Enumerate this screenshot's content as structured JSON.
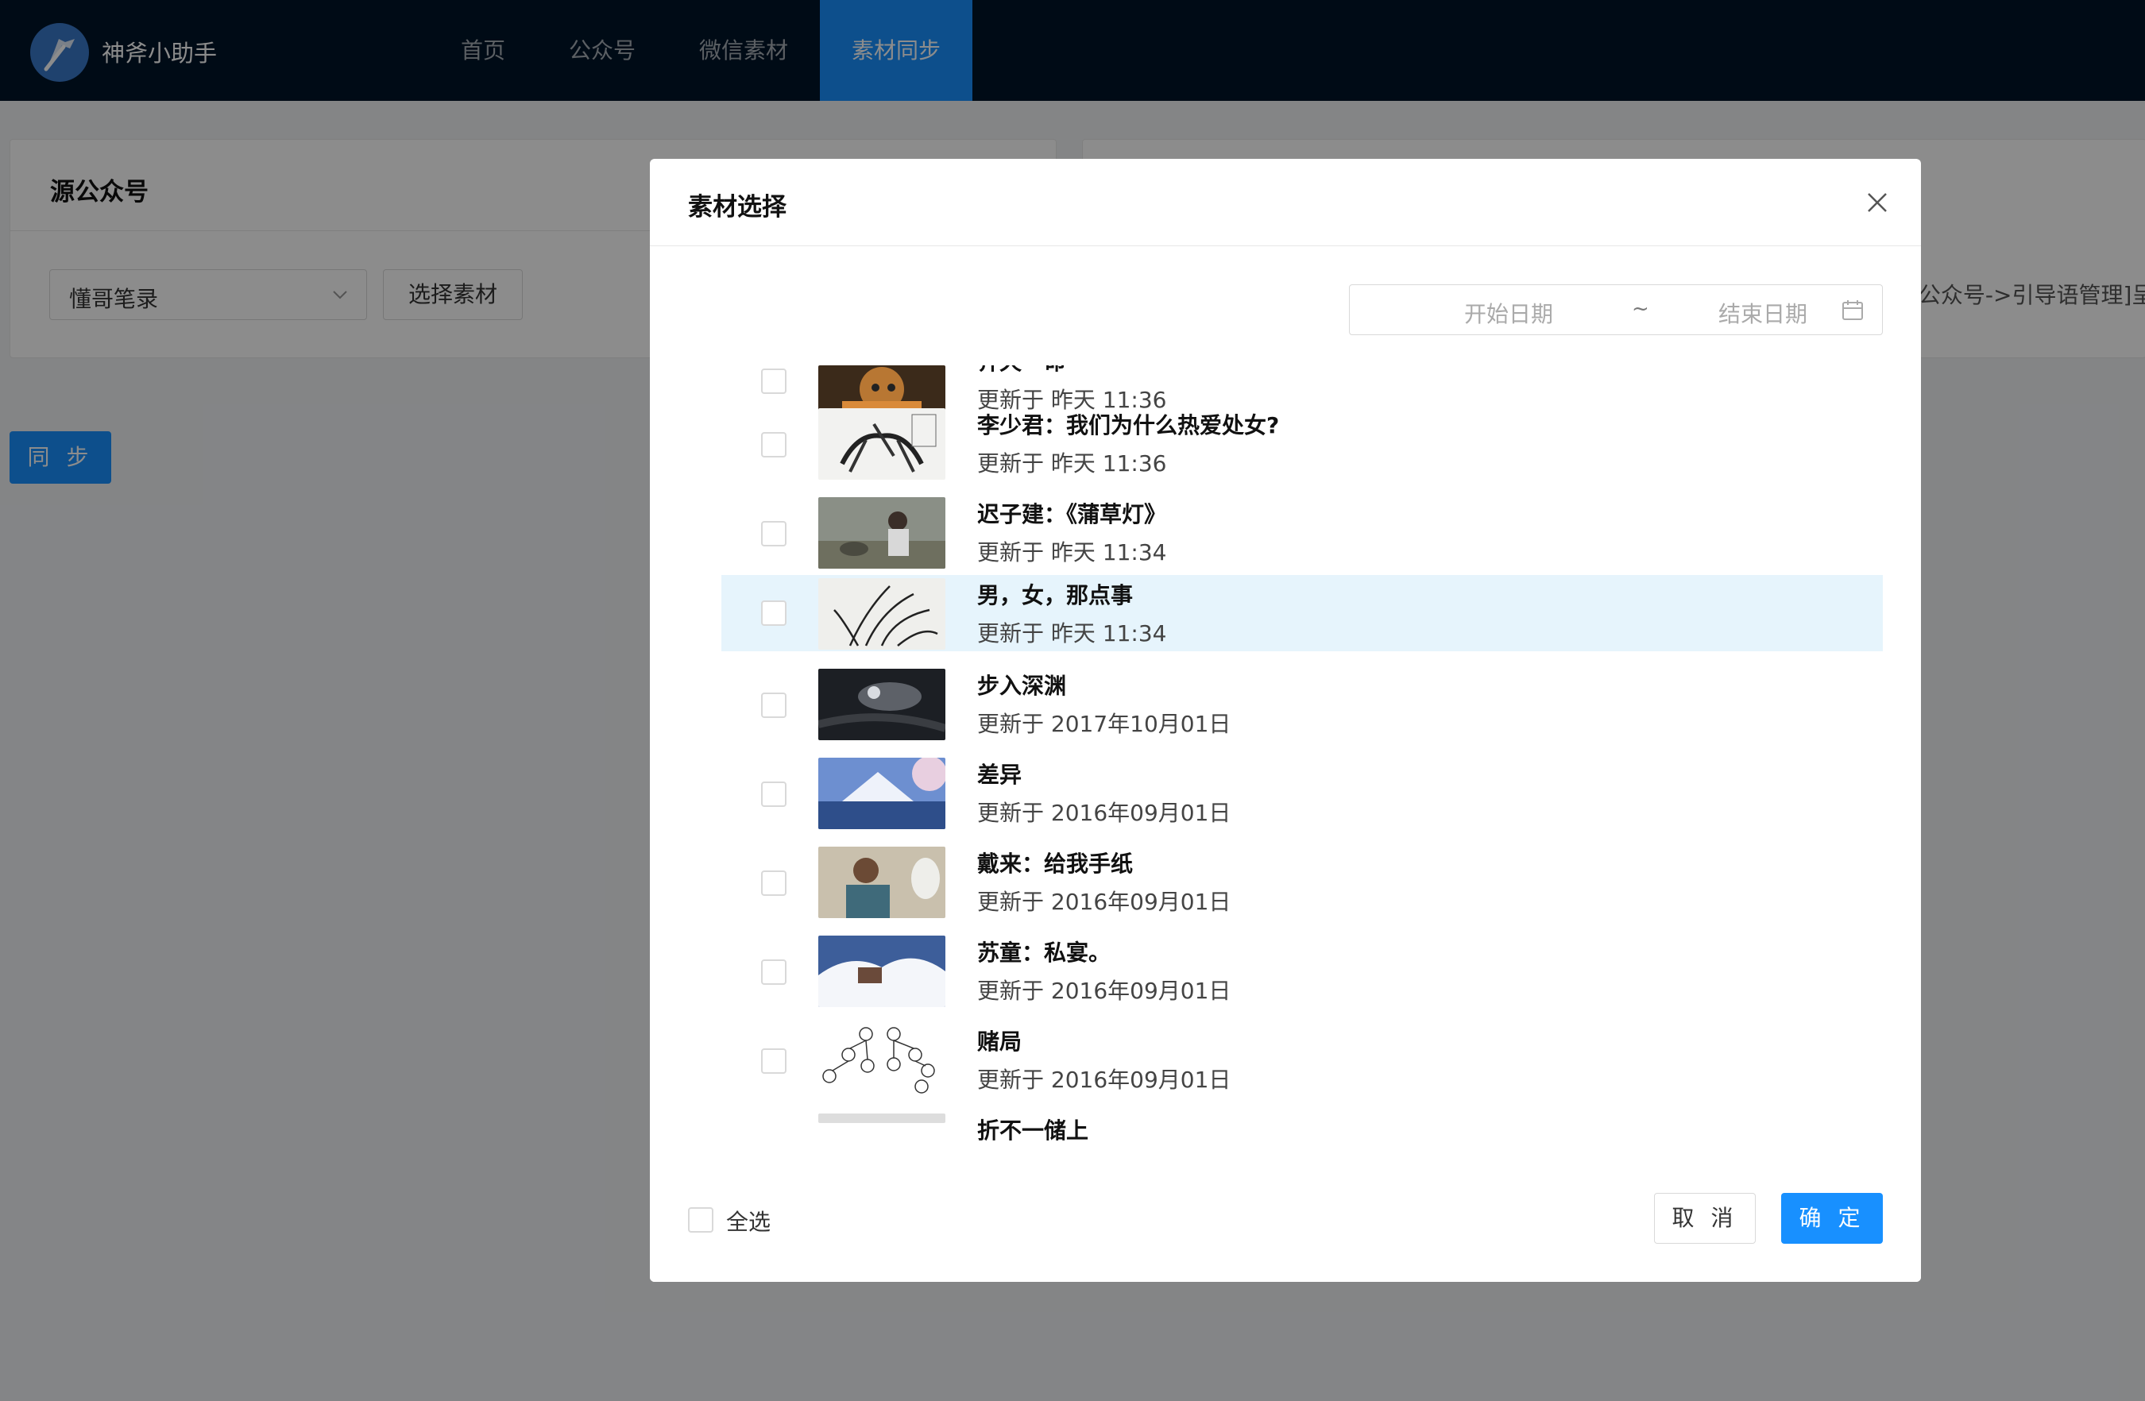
{
  "app": {
    "brand": "神斧小助手"
  },
  "nav": [
    {
      "label": "首页"
    },
    {
      "label": "公众号"
    },
    {
      "label": "微信素材"
    },
    {
      "label": "素材同步"
    }
  ],
  "source_panel": {
    "title": "源公众号",
    "account_select": "懂哥笔录",
    "choose_button": "选择素材"
  },
  "sync_button": "同 步",
  "right_hint": "[公众号->引导语管理]呈",
  "modal": {
    "title": "素材选择",
    "date_start_placeholder": "开始日期",
    "date_separator": "~",
    "date_end_placeholder": "结束日期",
    "items": [
      {
        "title": "齐天一命",
        "updated": "更新于 昨天 11:36"
      },
      {
        "title": "李少君：我们为什么热爱处女?",
        "updated": "更新于 昨天 11:36"
      },
      {
        "title": "迟子建：《蒲草灯》",
        "updated": "更新于 昨天 11:34"
      },
      {
        "title": "男，女，那点事",
        "updated": "更新于 昨天 11:34"
      },
      {
        "title": "步入深渊",
        "updated": "更新于 2017年10月01日"
      },
      {
        "title": "差异",
        "updated": "更新于 2016年09月01日"
      },
      {
        "title": "戴来：给我手纸",
        "updated": "更新于 2016年09月01日"
      },
      {
        "title": "苏童：私宴。",
        "updated": "更新于 2016年09月01日"
      },
      {
        "title": "赌局",
        "updated": "更新于 2016年09月01日"
      },
      {
        "title": "折不一储上",
        "updated": ""
      }
    ],
    "select_all": "全选",
    "cancel": "取 消",
    "ok": "确 定"
  },
  "colors": {
    "primary": "#1890ff",
    "nav_bg": "#001529",
    "hover_row": "#e6f4fc"
  }
}
